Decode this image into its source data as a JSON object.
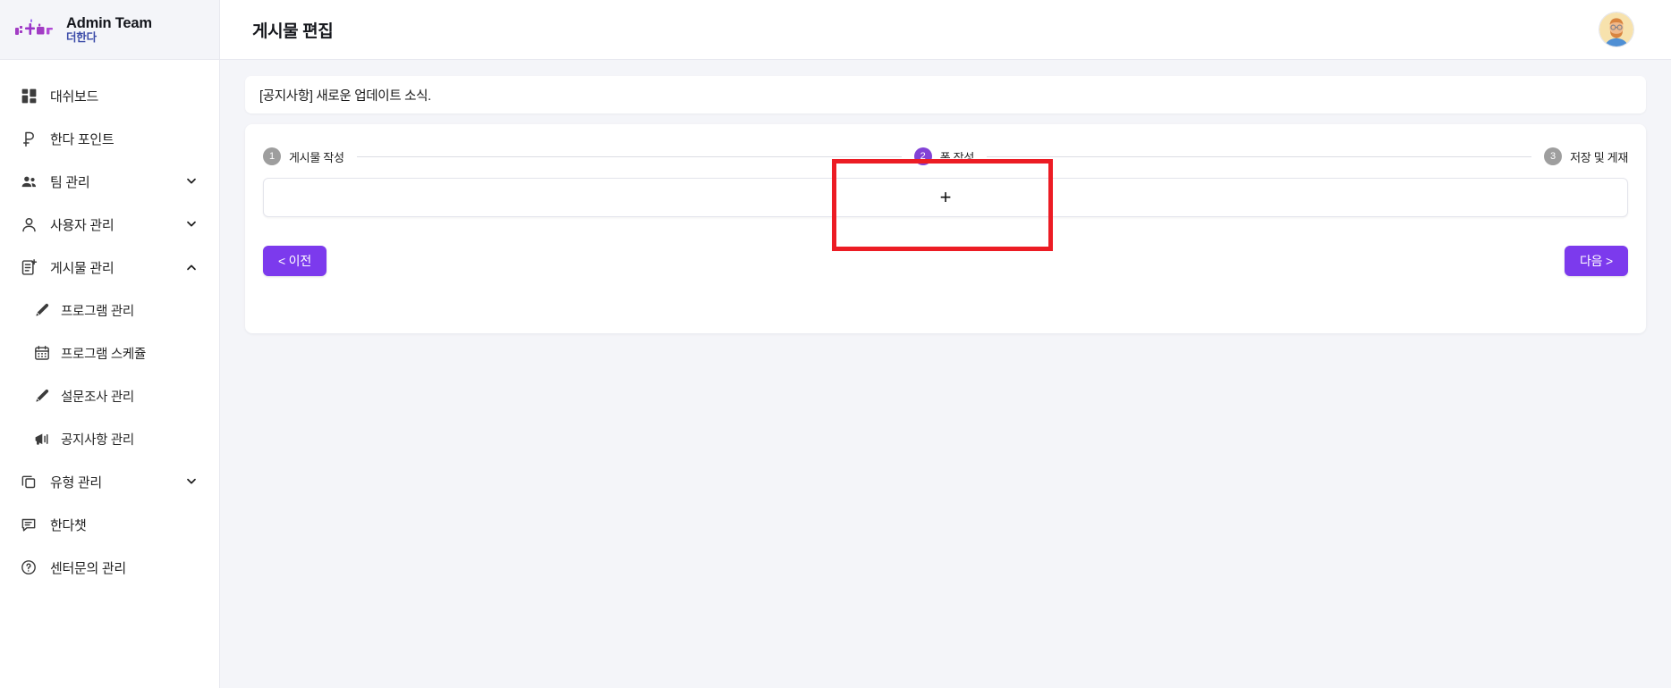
{
  "brand": {
    "logo_icon": "deohanda-logo-icon",
    "logo_text": "더+한다",
    "title": "Admin Team",
    "subtitle": "더한다"
  },
  "sidebar": {
    "items": [
      {
        "label": "대쉬보드",
        "icon": "dashboard-icon",
        "level": 0,
        "chevron": ""
      },
      {
        "label": "한다 포인트",
        "icon": "point-icon",
        "level": 0,
        "chevron": ""
      },
      {
        "label": "팀 관리",
        "icon": "team-icon",
        "level": 0,
        "chevron": "down"
      },
      {
        "label": "사용자 관리",
        "icon": "user-icon",
        "level": 0,
        "chevron": "down"
      },
      {
        "label": "게시물 관리",
        "icon": "post-add-icon",
        "level": 0,
        "chevron": "up"
      },
      {
        "label": "프로그램 관리",
        "icon": "pencil-icon",
        "level": 1,
        "chevron": ""
      },
      {
        "label": "프로그램 스케쥴",
        "icon": "calendar-icon",
        "level": 1,
        "chevron": ""
      },
      {
        "label": "설문조사 관리",
        "icon": "pencil-icon",
        "level": 1,
        "chevron": ""
      },
      {
        "label": "공지사항 관리",
        "icon": "megaphone-icon",
        "level": 1,
        "chevron": ""
      },
      {
        "label": "유형 관리",
        "icon": "copy-icon",
        "level": 0,
        "chevron": "down"
      },
      {
        "label": "한다챗",
        "icon": "chat-icon",
        "level": 0,
        "chevron": ""
      },
      {
        "label": "센터문의 관리",
        "icon": "help-circle-icon",
        "level": 0,
        "chevron": ""
      }
    ]
  },
  "topbar": {
    "title": "게시물 편집",
    "avatar_icon": "user-avatar"
  },
  "notice": {
    "title": "[공지사항] 새로운 업데이트 소식."
  },
  "stepper": {
    "steps": [
      {
        "number": "1",
        "label": "게시물 작성",
        "state": "inactive"
      },
      {
        "number": "2",
        "label": "폼 작성",
        "state": "active"
      },
      {
        "number": "3",
        "label": "저장 및 게재",
        "state": "inactive"
      }
    ]
  },
  "form_builder": {
    "add_label": "+",
    "add_icon": "plus-icon"
  },
  "actions": {
    "prev_label": "< 이전",
    "next_label": "다음 >"
  },
  "annotation": {
    "color": "#ec1c24",
    "shape": "rectangle-highlight"
  },
  "colors": {
    "accent": "#7c3aed",
    "step_active": "#8342d6",
    "step_inactive": "#9e9e9e",
    "brand_sub": "#3b4ba8",
    "annotation": "#ec1c24",
    "page_bg": "#f4f5f9"
  }
}
